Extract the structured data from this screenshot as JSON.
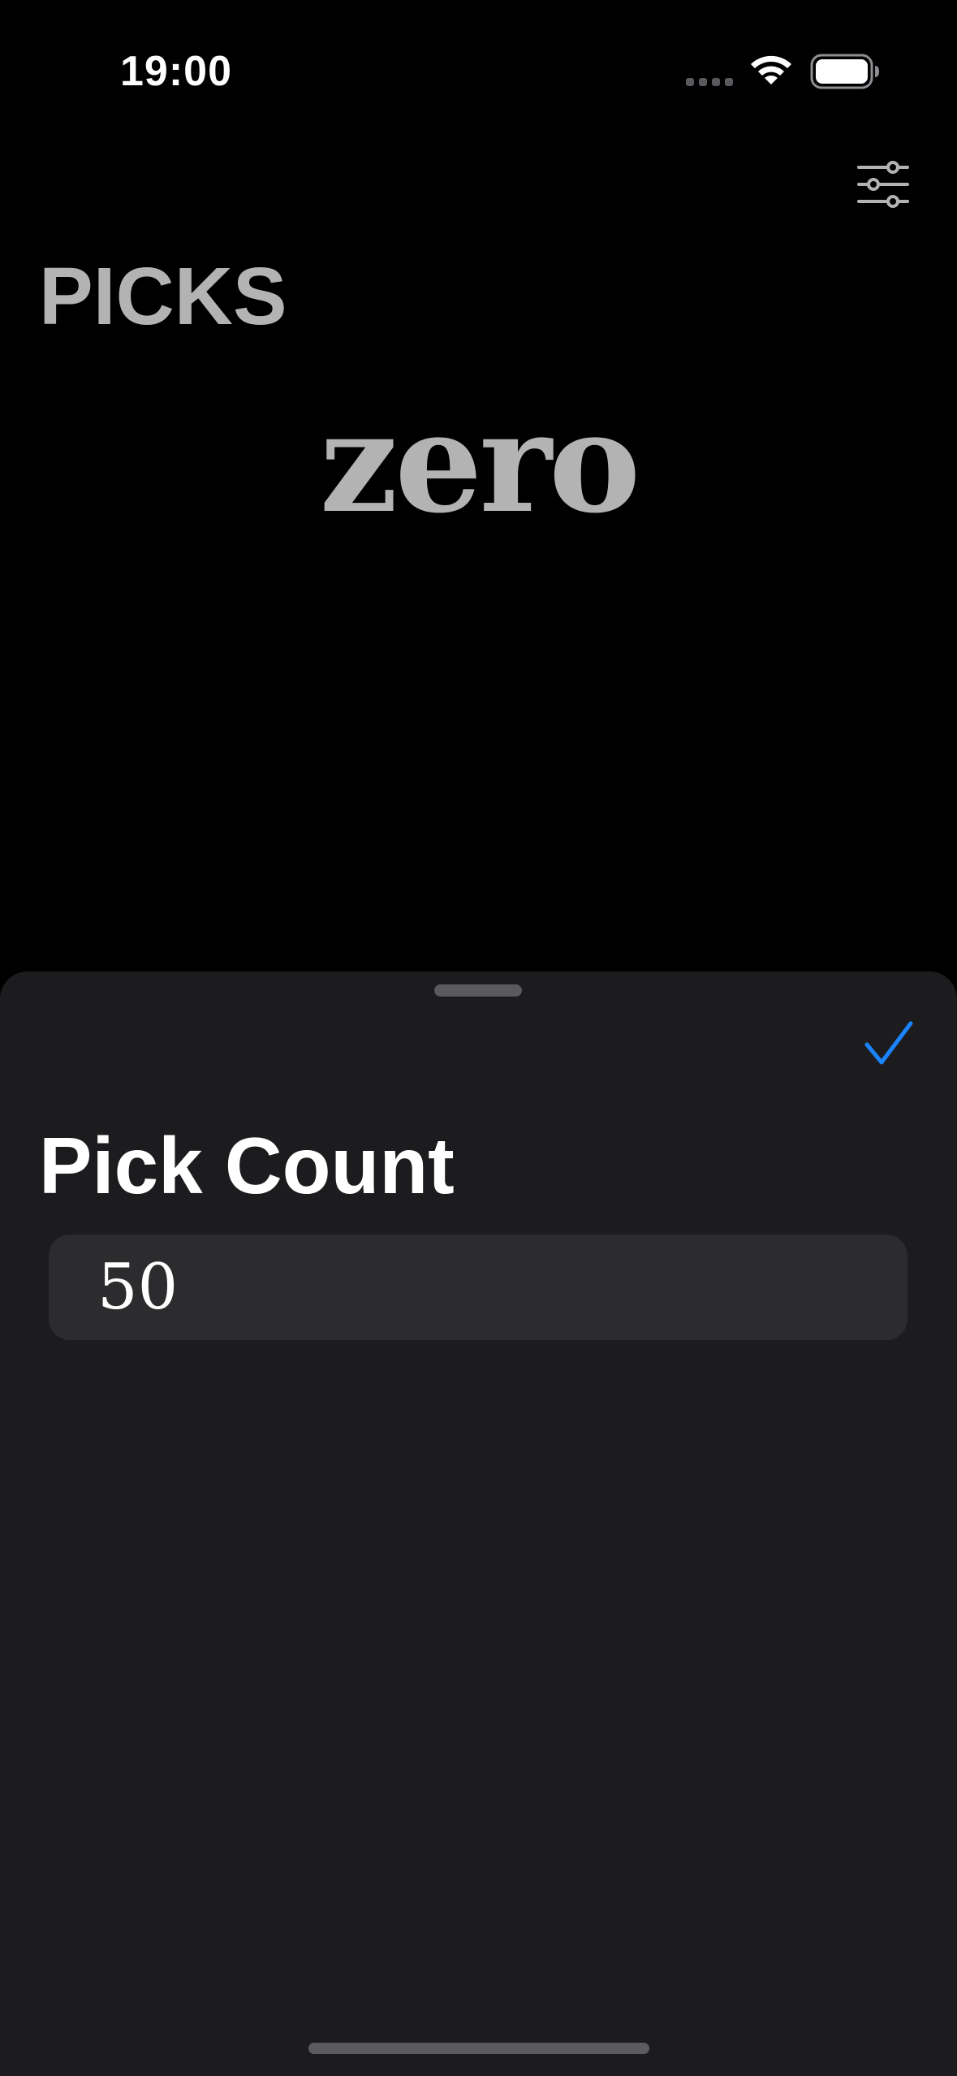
{
  "status_bar": {
    "time": "19:00",
    "signal_icon": "cellular-dots-icon",
    "wifi_icon": "wifi-icon",
    "battery_icon": "battery-icon"
  },
  "header": {
    "filter_icon": "sliders-icon",
    "title": "PICKS"
  },
  "hero": {
    "word": "zero"
  },
  "sheet": {
    "done_icon": "checkmark-icon",
    "title": "Pick Count",
    "count_value": "50"
  },
  "colors": {
    "background": "#000000",
    "sheet_background": "#1c1c1e",
    "field_background": "#2c2c2e",
    "accent": "#1a84ff",
    "muted_text": "#b3b3b3"
  }
}
